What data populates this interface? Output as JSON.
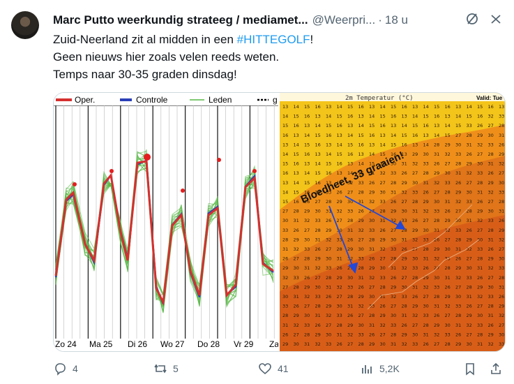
{
  "tweet": {
    "author": "Marc Putto weerkundig strateeg / mediamet...",
    "handle": "@Weerpri...",
    "time": "18 u",
    "lines": [
      {
        "before": "Zuid-Neerland zit al midden in een ",
        "hashtag": "#HITTEGOLF",
        "after": "!"
      },
      {
        "text": "Geen nieuws hier zoals velen reeds weten."
      },
      {
        "text": "Temps naar 30-35 graden dinsdag!"
      }
    ]
  },
  "left_chart": {
    "legend": [
      "Oper.",
      "Controle",
      "Leden",
      "g"
    ],
    "x_labels": [
      "Zo 24",
      "Ma 25",
      "Di 26",
      "Wo 27",
      "Do 28",
      "Vr 29",
      "Za"
    ],
    "colors": {
      "oper": "#d62f2f",
      "controle": "#2b3fb8",
      "leden": "#56b845"
    }
  },
  "right_map": {
    "title": "2m Temperatur (°C)",
    "valid": "Valid: Tue",
    "annotation": "Bloedheet, 33 graaien!",
    "colors": {
      "cool": "#f3c41a",
      "warm": "#ef8f1a",
      "hot": "#d85e18"
    }
  },
  "actions": {
    "replies": "4",
    "reposts": "5",
    "likes": "41",
    "views": "5,2K"
  }
}
